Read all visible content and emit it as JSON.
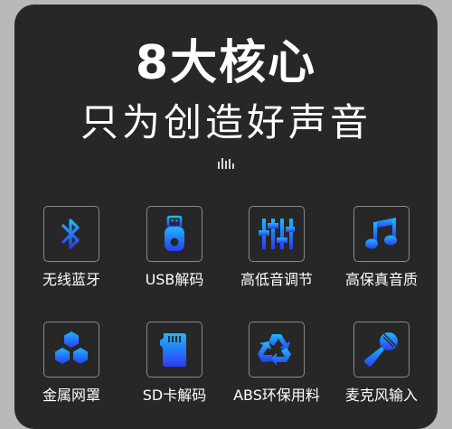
{
  "header": {
    "title": "8大核心",
    "subtitle": "只为创造好声音"
  },
  "features": [
    {
      "label": "无线蓝牙",
      "icon": "bluetooth-icon"
    },
    {
      "label": "USB解码",
      "icon": "usb-drive-icon"
    },
    {
      "label": "高低音调节",
      "icon": "equalizer-icon"
    },
    {
      "label": "高保真音质",
      "icon": "music-note-icon"
    },
    {
      "label": "金属网罩",
      "icon": "hexagon-mesh-icon"
    },
    {
      "label": "SD卡解码",
      "icon": "sd-card-icon"
    },
    {
      "label": "ABS环保用料",
      "icon": "recycle-icon"
    },
    {
      "label": "麦克风输入",
      "icon": "microphone-icon"
    }
  ],
  "colors": {
    "background": "#b9b9bb",
    "card": "#272727",
    "icon_gradient_top": "#1fb8ff",
    "icon_gradient_bottom": "#2a3cf0"
  }
}
